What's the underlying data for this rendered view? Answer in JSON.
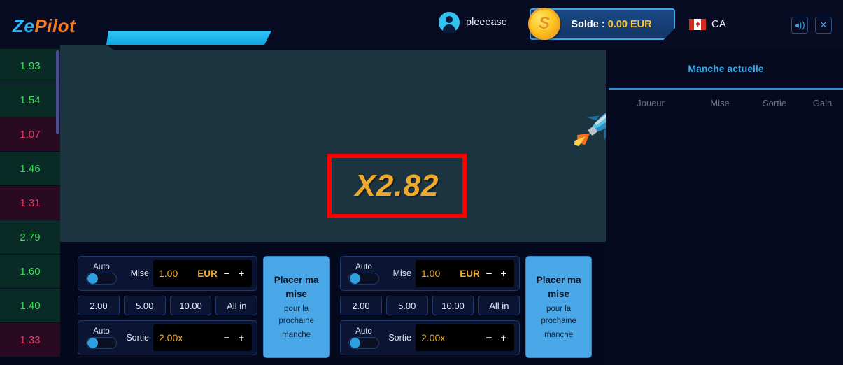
{
  "header": {
    "logo_ze": "Ze",
    "logo_pilot": "Pilot",
    "username": "pleeease",
    "avatar_icon": "user-avatar-icon",
    "coin_icon": "coin-dollar-icon",
    "coin_symbol": "S",
    "balance_label": "Solde : ",
    "balance_amount": "0.00 EUR",
    "locale_code": "CA",
    "flag_icon": "canada-flag-icon",
    "sound_icon": "speaker-icon",
    "sound_glyph": "◂))",
    "close_icon": "close-icon",
    "close_glyph": "✕"
  },
  "sidebar": {
    "name": "round-history-list",
    "items": [
      {
        "value": "1.93",
        "state": "green"
      },
      {
        "value": "1.54",
        "state": "green"
      },
      {
        "value": "1.07",
        "state": "red"
      },
      {
        "value": "1.46",
        "state": "green"
      },
      {
        "value": "1.31",
        "state": "red"
      },
      {
        "value": "2.79",
        "state": "green"
      },
      {
        "value": "1.60",
        "state": "green"
      },
      {
        "value": "1.40",
        "state": "green"
      },
      {
        "value": "1.33",
        "state": "red"
      }
    ]
  },
  "game": {
    "multiplier": "X2.82",
    "multiplier_highlight_color": "#ff0000",
    "multiplier_color": "#f0a92b",
    "rocket_icon": "rocket-icon",
    "canvas_bg": "#1b3440"
  },
  "bets": [
    {
      "auto_bet_label": "Auto",
      "stake_label": "Mise",
      "stake_value": "1.00",
      "currency": "EUR",
      "minus": "−",
      "plus": "+",
      "quick": [
        "2.00",
        "5.00",
        "10.00",
        "All in"
      ],
      "auto_cashout_label": "Auto",
      "cashout_label": "Sortie",
      "cashout_value": "2.00x",
      "place_line1": "Placer ma",
      "place_line2": "mise",
      "place_sub1": "pour la prochaine",
      "place_sub2": "manche"
    },
    {
      "auto_bet_label": "Auto",
      "stake_label": "Mise",
      "stake_value": "1.00",
      "currency": "EUR",
      "minus": "−",
      "plus": "+",
      "quick": [
        "2.00",
        "5.00",
        "10.00",
        "All in"
      ],
      "auto_cashout_label": "Auto",
      "cashout_label": "Sortie",
      "cashout_value": "2.00x",
      "place_line1": "Placer ma",
      "place_line2": "mise",
      "place_sub1": "pour la prochaine",
      "place_sub2": "manche"
    }
  ],
  "right_panel": {
    "tab_label": "Manche actuelle",
    "columns": [
      "Joueur",
      "Mise",
      "Sortie",
      "Gain"
    ],
    "rows": []
  }
}
